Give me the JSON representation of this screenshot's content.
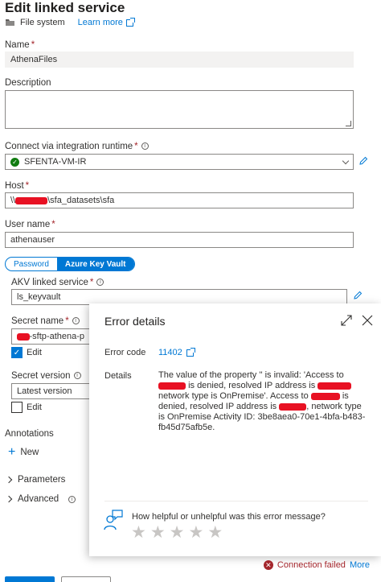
{
  "header": {
    "title": "Edit linked service",
    "type_label": "File system",
    "learn_more": "Learn more"
  },
  "form": {
    "name_label": "Name",
    "name_value": "AthenaFiles",
    "description_label": "Description",
    "runtime_label": "Connect via integration runtime",
    "runtime_value": "SFENTA-VM-IR",
    "host_label": "Host",
    "host_prefix": "\\\\",
    "host_suffix": "\\sfa_datasets\\sfa",
    "username_label": "User name",
    "username_value": "athenauser",
    "auth_options": [
      "Password",
      "Azure Key Vault"
    ],
    "akv_label": "AKV linked service",
    "akv_value": "ls_keyvault",
    "secret_name_label": "Secret name",
    "secret_name_value": "-sftp-athena-p",
    "edit_label": "Edit",
    "secret_version_label": "Secret version",
    "secret_version_value": "Latest version",
    "edit2_label": "Edit",
    "annotations_label": "Annotations",
    "new_label": "New",
    "parameters_label": "Parameters",
    "advanced_label": "Advanced"
  },
  "error_panel": {
    "title": "Error details",
    "error_code_label": "Error code",
    "error_code_value": "11402",
    "details_label": "Details",
    "details_p1": "The value of the property '' is invalid: 'Access to",
    "details_p2": "is denied, resolved IP address is",
    "details_p3": "network type is OnPremise'. Access to",
    "details_p4": "is denied, resolved IP address is",
    "details_p5": ", network type is OnPremise Activity ID: 3be8aea0-70e1-4bfa-b483-fb45d75afb5e.",
    "feedback_question": "How helpful or unhelpful was this error message?",
    "star_count": 5
  },
  "footer": {
    "status_text": "Connection failed",
    "more_link": "More"
  },
  "colors": {
    "accent": "#0078d4",
    "error": "#a4262c",
    "success": "#107c10"
  }
}
